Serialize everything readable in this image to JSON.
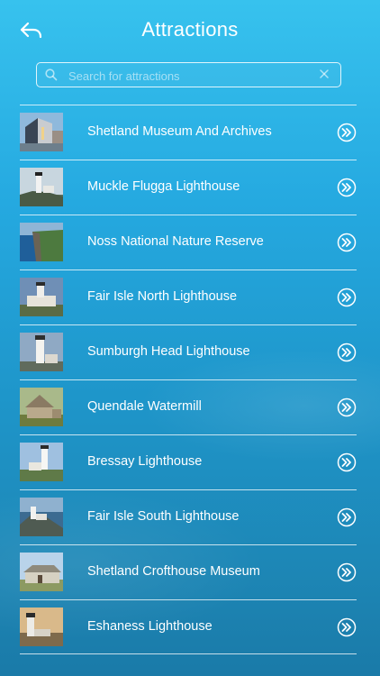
{
  "header": {
    "title": "Attractions",
    "back_icon": "back-arrow-icon"
  },
  "search": {
    "placeholder": "Search for attractions",
    "value": ""
  },
  "colors": {
    "background_top": "#37c2ee",
    "background_bottom": "#1a7aa8",
    "text": "#ffffff"
  },
  "attractions": [
    {
      "label": "Shetland Museum And Archives"
    },
    {
      "label": "Muckle Flugga Lighthouse"
    },
    {
      "label": "Noss National Nature Reserve"
    },
    {
      "label": "Fair Isle North Lighthouse"
    },
    {
      "label": "Sumburgh Head Lighthouse"
    },
    {
      "label": "Quendale Watermill"
    },
    {
      "label": "Bressay Lighthouse"
    },
    {
      "label": "Fair Isle South Lighthouse"
    },
    {
      "label": "Shetland Crofthouse Museum"
    },
    {
      "label": "Eshaness Lighthouse"
    }
  ]
}
